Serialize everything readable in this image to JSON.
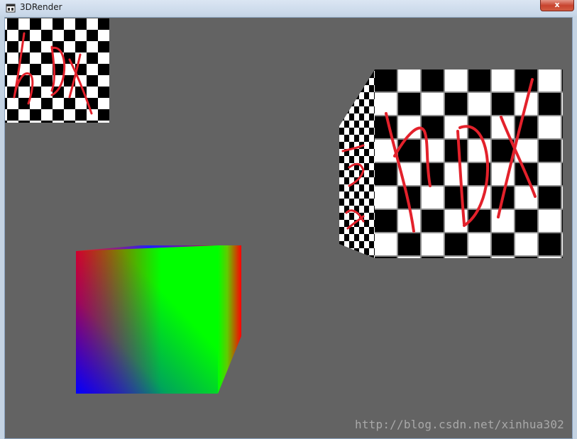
{
  "window": {
    "title": "3DRender",
    "close_label": "x"
  },
  "viewport": {
    "background_color": "#636363",
    "texture_text": "HDX",
    "watermark": "http://blog.csdn.net/xinhua302"
  },
  "colors": {
    "checker_dark": "#000000",
    "checker_light": "#ffffff",
    "handwriting": "#e3212b",
    "vertex_red": "#ff0000",
    "vertex_green": "#00ff00",
    "vertex_blue": "#0000ff"
  },
  "icons": {
    "app": "window-app-icon",
    "close": "close-icon"
  }
}
